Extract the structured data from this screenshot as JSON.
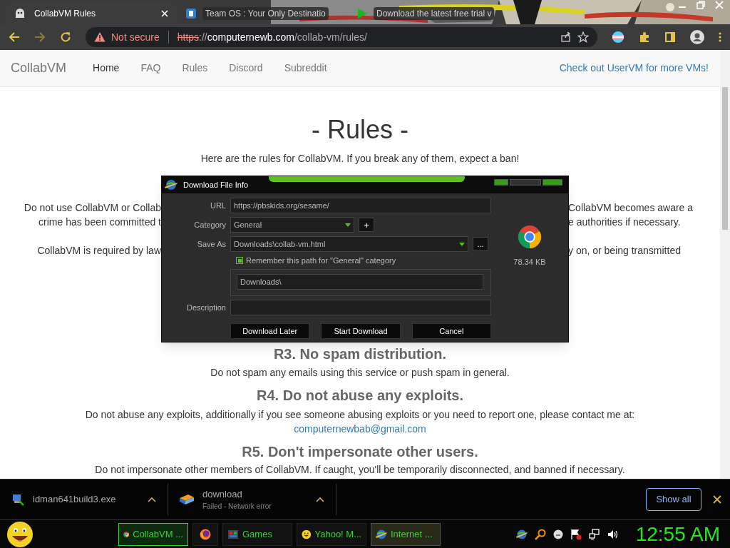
{
  "tabs": [
    {
      "title": "CollabVM Rules",
      "selected": true
    },
    {
      "title": "Team OS : Your Only Destinatio",
      "selected": false
    },
    {
      "title": "Download the latest free trial v",
      "selected": false
    }
  ],
  "address_bar": {
    "security": "Not secure",
    "scheme": "https",
    "separator": "://",
    "host": "computernewb.com",
    "path": "/collab-vm/rules/"
  },
  "site_nav": {
    "brand_light": "Collab",
    "brand_dark": "VM",
    "links": [
      {
        "label": "Home",
        "selected": true
      },
      {
        "label": "FAQ",
        "selected": false
      },
      {
        "label": "Rules",
        "selected": false
      },
      {
        "label": "Discord",
        "selected": false
      },
      {
        "label": "Subreddit",
        "selected": false
      }
    ],
    "promo": "Check out UserVM for more VMs!"
  },
  "page": {
    "title": "- Rules -",
    "intro": "Here are the rules for CollabVM. If you break any of them, expect a ban!",
    "partial_lines": [
      {
        "left": "Do not use CollabVM or Collab",
        "right": "CollabVM becomes aware a"
      },
      {
        "left": "crime has been committed t",
        "right": "e authorities if necessary."
      },
      {
        "left": "CollabVM is required by law",
        "right": "y on, or being transmitted"
      }
    ],
    "rules": [
      {
        "heading": "R3. No spam distribution.",
        "text": "Do not spam any emails using this service or push spam in general."
      },
      {
        "heading": "R4. Do not abuse any exploits.",
        "text": "Do not abuse any exploits, additionally if you see someone abusing exploits or you need to report one, please contact me at:",
        "link": "computernewbab@gmail.com"
      },
      {
        "heading": "R5. Don't impersonate other users.",
        "text": "Do not impersonate other members of CollabVM. If caught, you'll be temporarily disconnected, and banned if necessary."
      }
    ]
  },
  "dialog": {
    "title": "Download File Info",
    "url_label": "URL",
    "url": "https://pbskids.org/sesame/",
    "category_label": "Category",
    "category": "General",
    "add_button": "+",
    "save_as_label": "Save As",
    "save_as": "Downloads\\collab-vm.html",
    "browse_button": "...",
    "remember": {
      "label": "Remember this path for \"General\" category",
      "checked": true
    },
    "remember_path": "Downloads\\",
    "description_label": "Description",
    "file_size": "78.34 KB",
    "buttons": [
      "Download Later",
      "Start Download",
      "Cancel"
    ]
  },
  "download_shelf": {
    "items": [
      {
        "kind": "installer",
        "name": "idman641build3.exe"
      },
      {
        "kind": "failed",
        "name": "download",
        "status": "Failed - Network error"
      }
    ],
    "show_all": "Show all"
  },
  "taskbar": {
    "tasks": [
      {
        "kind": "chrome",
        "label": "CollabVM ...",
        "selected": true
      },
      {
        "kind": "firefox",
        "selected": false
      },
      {
        "kind": "games",
        "label": "Games",
        "selected": false
      },
      {
        "kind": "yahoo",
        "label": "Yahoo! M...",
        "selected": false
      },
      {
        "kind": "idm",
        "label": "Internet ...",
        "selected": true
      }
    ],
    "clock": "12:55 AM"
  }
}
